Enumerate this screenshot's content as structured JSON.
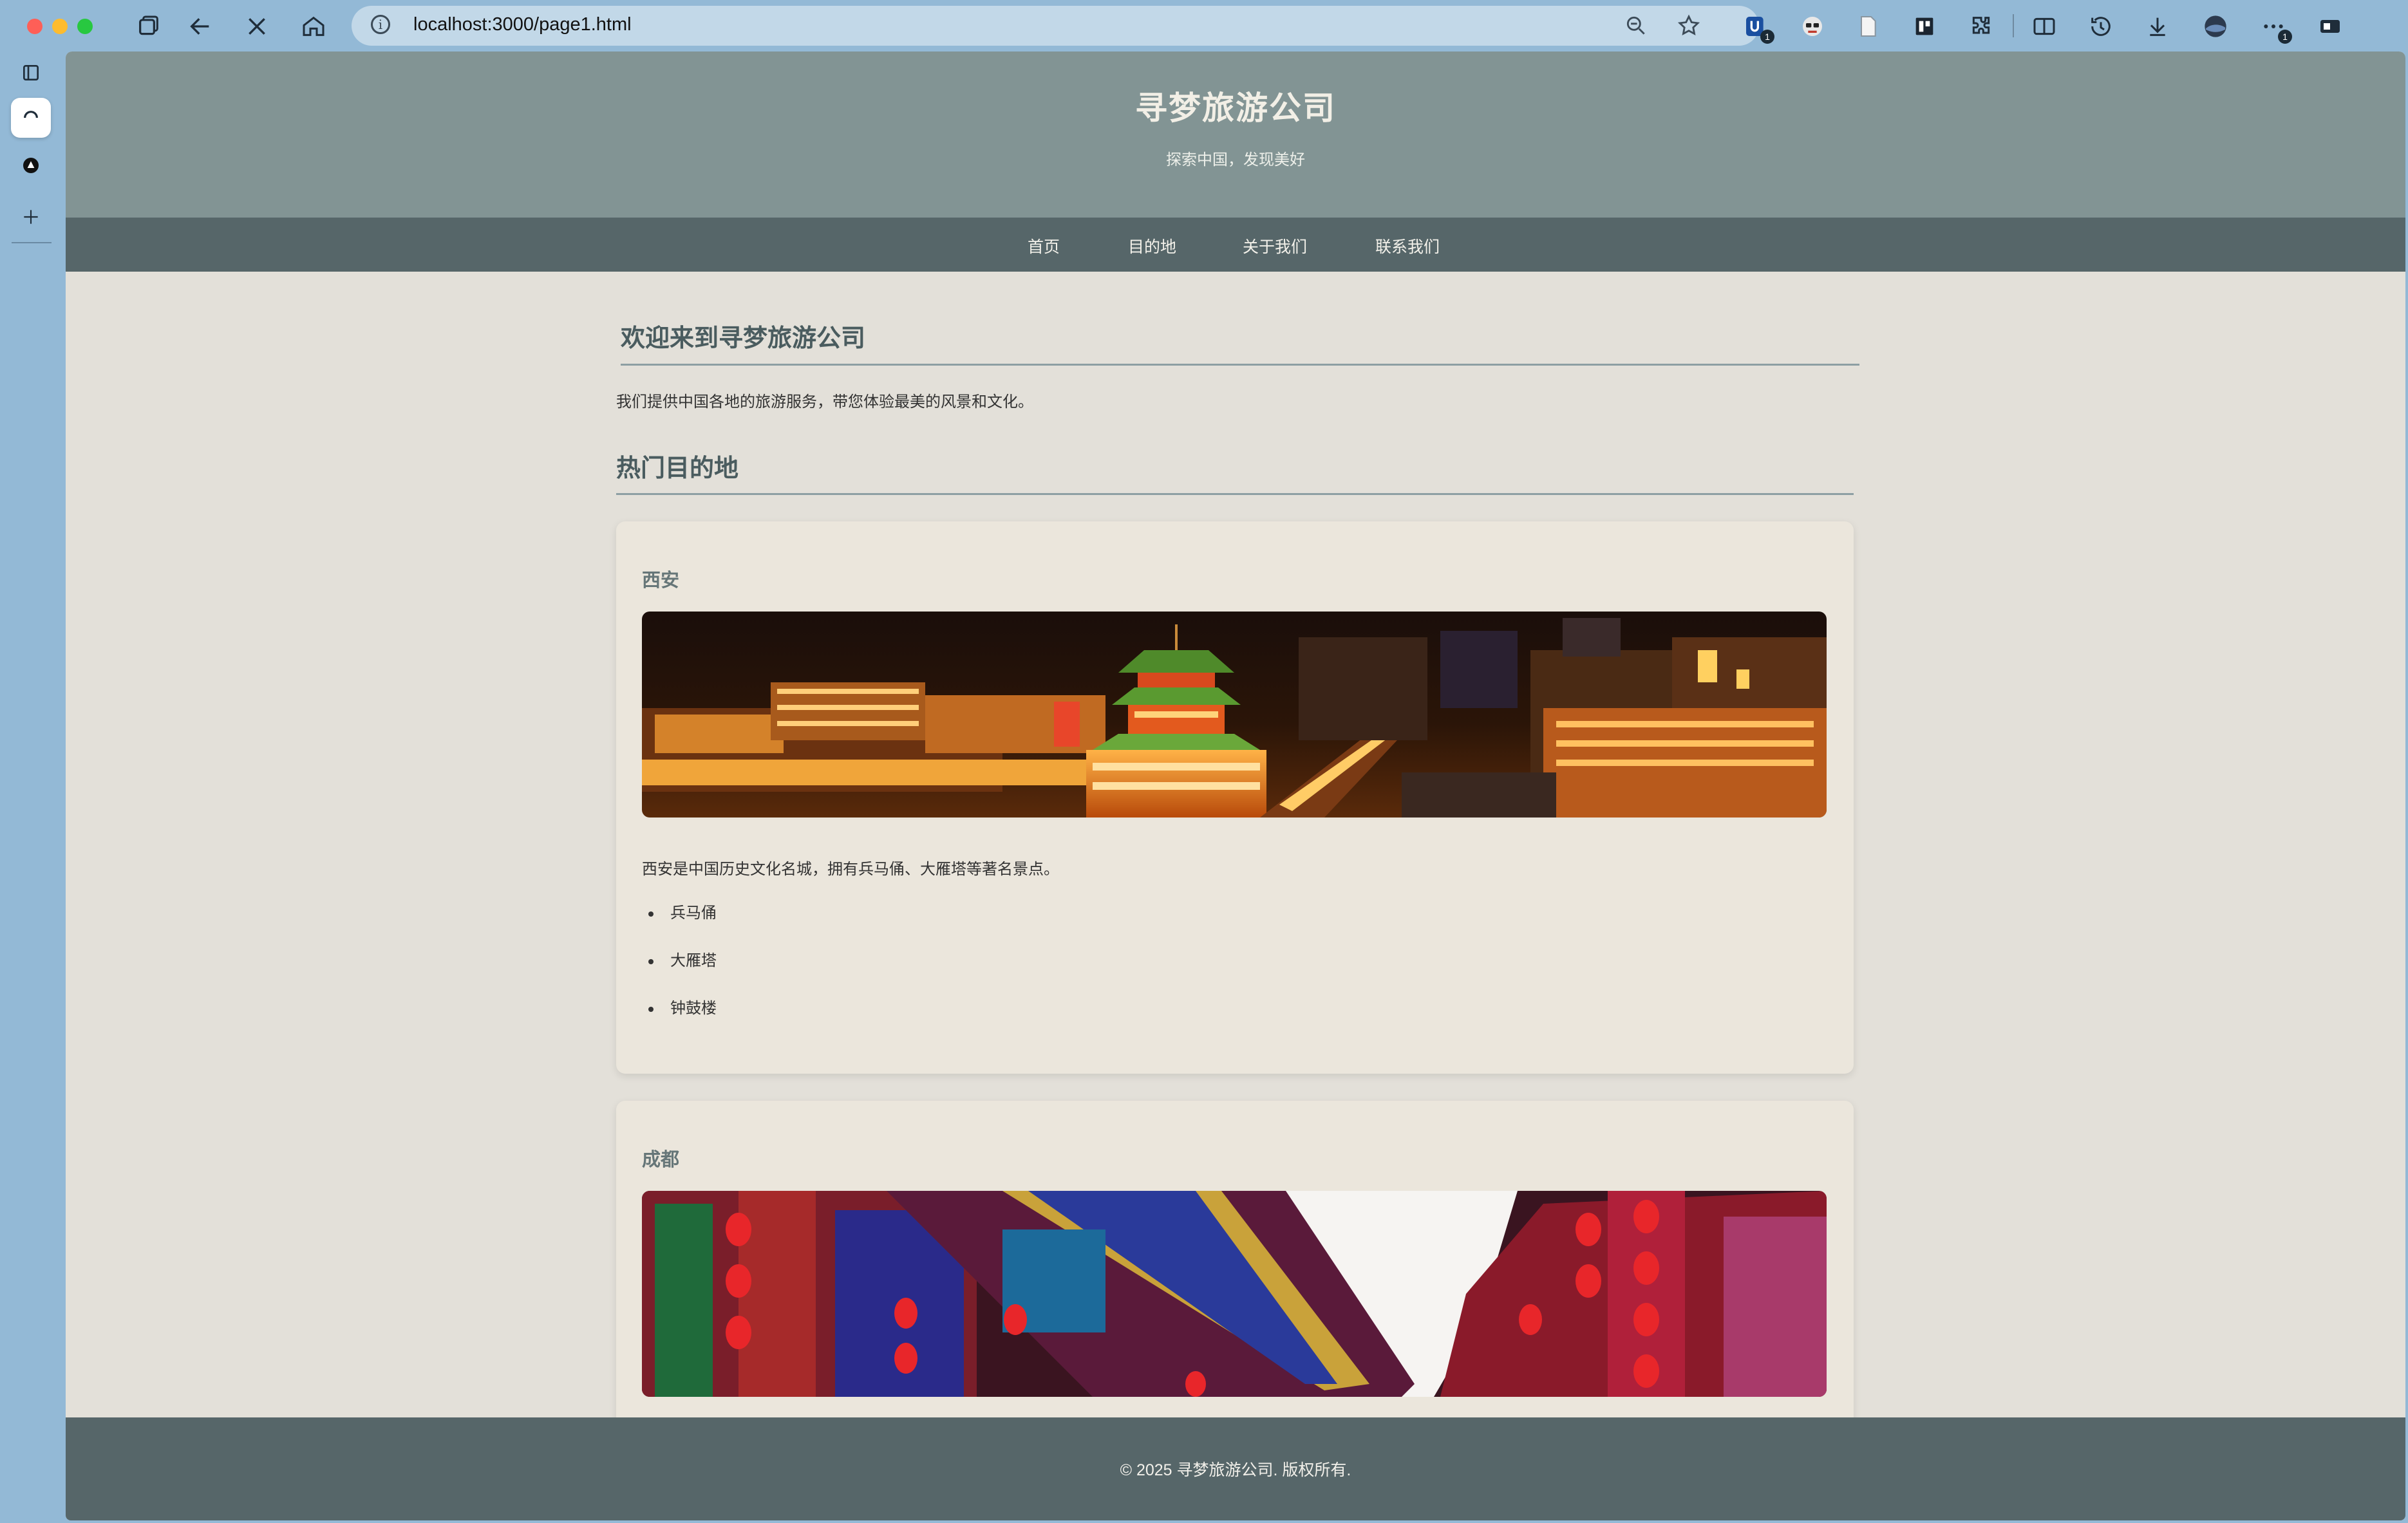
{
  "browser": {
    "url": "localhost:3000/page1.html",
    "extension_badge_count": "1",
    "more_badge_count": "1"
  },
  "site": {
    "title": "寻梦旅游公司",
    "subtitle": "探索中国，发现美好",
    "nav": [
      {
        "label": "首页"
      },
      {
        "label": "目的地"
      },
      {
        "label": "关于我们"
      },
      {
        "label": "联系我们"
      }
    ]
  },
  "main": {
    "welcome_heading": "欢迎来到寻梦旅游公司",
    "welcome_text": "我们提供中国各地的旅游服务，带您体验最美的风景和文化。",
    "popular_heading": "热门目的地",
    "destinations": [
      {
        "name": "西安",
        "image_icon": "xian-drum-tower-night-photo",
        "description": "西安是中国历史文化名城，拥有兵马俑、大雁塔等著名景点。",
        "attractions": [
          "兵马俑",
          "大雁塔",
          "钟鼓楼"
        ]
      },
      {
        "name": "成都",
        "image_icon": "chengdu-lantern-street-photo"
      }
    ]
  },
  "footer": {
    "text": "© 2025 寻梦旅游公司. 版权所有."
  },
  "colors": {
    "header_bg": "#829494",
    "nav_bg": "#566669",
    "page_bg": "#e3e0d9",
    "card_bg": "#ebe6dc",
    "heading": "#4a5c5f"
  }
}
